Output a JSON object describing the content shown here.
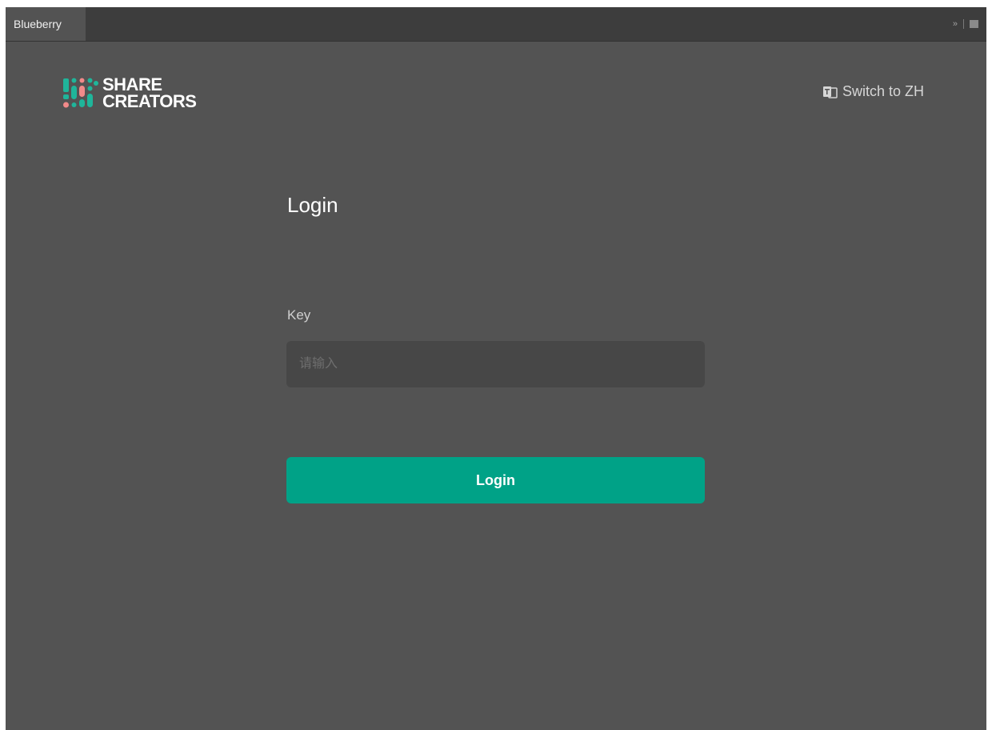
{
  "window": {
    "tab_title": "Blueberry",
    "controls": {
      "expand_icon": "double-chevron-right-icon",
      "menu_icon": "panel-menu-icon",
      "expand_glyph": "»"
    }
  },
  "header": {
    "logo": {
      "line1": "SHARE",
      "line2": "CREATORS",
      "colors": {
        "teal": "#1fb59a",
        "pink": "#f28a8a",
        "text": "#ffffff"
      }
    },
    "language_switch": {
      "label": "Switch to ZH",
      "icon": "translate-icon"
    }
  },
  "form": {
    "title": "Login",
    "key_label": "Key",
    "key_placeholder": "请输入",
    "key_value": "",
    "submit_label": "Login"
  },
  "colors": {
    "background": "#535353",
    "tab_bar": "#3d3d3d",
    "input_bg": "#474747",
    "accent": "#00a287"
  }
}
